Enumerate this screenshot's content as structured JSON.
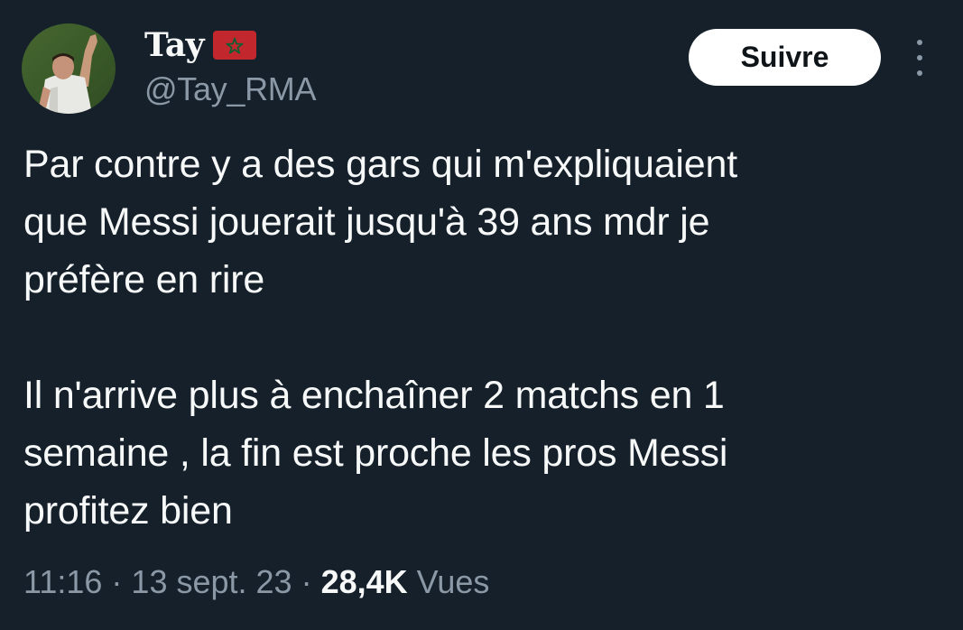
{
  "author": {
    "display_name": "Tay",
    "flag_icon": "morocco-flag-icon",
    "handle": "@Tay_RMA"
  },
  "follow_button": {
    "label": "Suivre"
  },
  "more_button": {
    "icon": "more-vertical-icon"
  },
  "tweet": {
    "text": "Par contre y a des gars qui m'expliquaient\nque Messi jouerait jusqu'à 39 ans mdr je\npréfère en rire\n\nIl n'arrive plus à enchaîner 2 matchs en 1\nsemaine , la fin est proche les pros Messi\nprofitez bien"
  },
  "meta": {
    "time": "11:16",
    "date": "13 sept. 23",
    "separator": "·",
    "views_count": "28,4K",
    "views_label": "Vues"
  },
  "colors": {
    "background": "#15202b",
    "primary_text": "#f7f9f9",
    "secondary_text": "#8b98a5",
    "button_bg": "#ffffff",
    "button_text": "#0f1419",
    "flag_red": "#c1272d",
    "flag_green": "#006233"
  }
}
